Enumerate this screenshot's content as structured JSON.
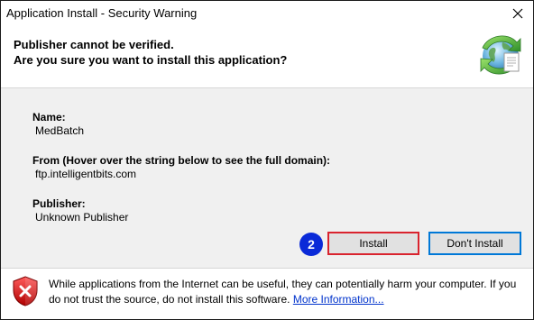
{
  "window": {
    "title": "Application Install - Security Warning"
  },
  "header": {
    "line1": "Publisher cannot be verified.",
    "line2": "Are you sure you want to install this application?",
    "icon": "globe-install-icon"
  },
  "details": {
    "name_label": "Name:",
    "name_value": "MedBatch",
    "from_label": "From (Hover over the string below to see the full domain):",
    "from_value": "ftp.intelligentbits.com",
    "publisher_label": "Publisher:",
    "publisher_value": "Unknown Publisher"
  },
  "buttons": {
    "install": "Install",
    "dont_install": "Don't Install"
  },
  "annotation": {
    "step": "2"
  },
  "footer": {
    "warning_text": "While applications from the Internet can be useful, they can potentially harm your computer. If you do not trust the source, do not install this software.",
    "link": "More Information...",
    "icon": "warning-shield-icon"
  },
  "colors": {
    "highlight_border": "#d9232e",
    "badge_fill": "#0a2ad8",
    "focus_border": "#0078d7",
    "link": "#0033cc"
  }
}
